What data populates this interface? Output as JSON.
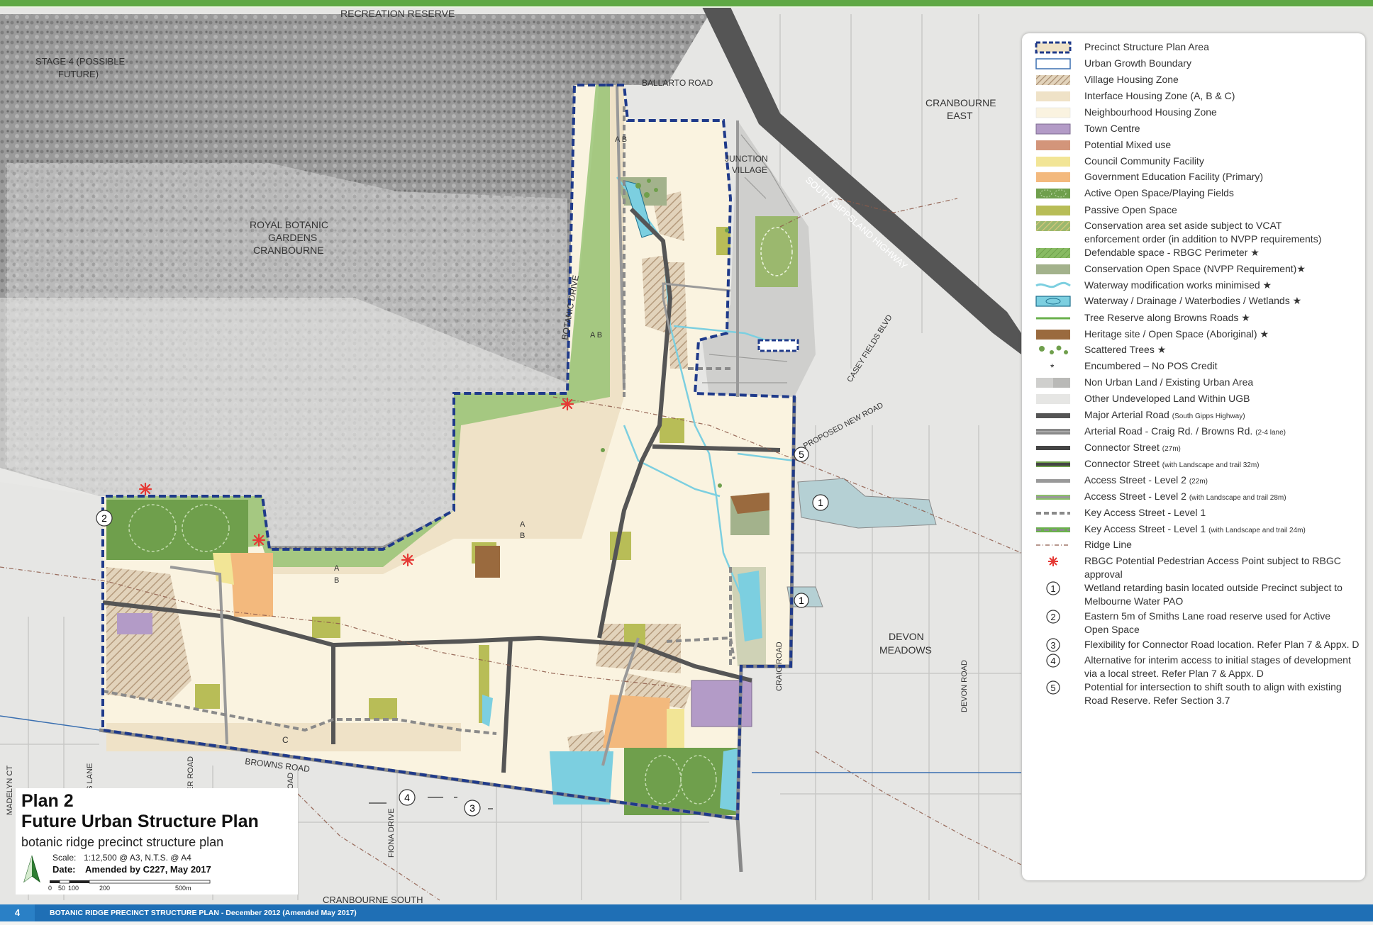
{
  "colors": {
    "boundary": "#1f3a8a",
    "neighbourhood": "#faf3e0",
    "interface": "#efe2c7",
    "village": "#c9b497",
    "town_centre": "#b39bc7",
    "gov_education": "#f3b97d",
    "council": "#f2e596",
    "active_open": "#6f9f4c",
    "passive_open": "#b8bd57",
    "conservation": "#a3b28c",
    "water": "#7ccfe0",
    "heritage": "#9a6a3e",
    "major_road": "#555555",
    "access_point": "#e53935",
    "footer": "#1f6fb5",
    "top_rule": "#5fa844"
  },
  "footer": {
    "page_number": "4",
    "text": "BOTANIC RIDGE PRECINCT STRUCTURE PLAN - December 2012 (Amended May 2017)"
  },
  "title_block": {
    "plan_number": "Plan 2",
    "title": "Future Urban Structure Plan",
    "subtitle": "botanic ridge precinct structure plan",
    "scale_label": "Scale:",
    "scale_value": "1:12,500 @ A3, N.T.S. @ A4",
    "date_label": "Date:",
    "date_value": "Amended by C227, May 2017",
    "scalebar_ticks": [
      "0",
      "50",
      "100",
      "200",
      "500m"
    ]
  },
  "map_labels": {
    "recreation_reserve": "RECREATION RESERVE",
    "stage4_line1": "STAGE 4 (POSSIBLE",
    "stage4_line2": "FUTURE)",
    "ballarto_road": "BALLARTO ROAD",
    "cranbourne_east_1": "CRANBOURNE",
    "cranbourne_east_2": "EAST",
    "junction_1": "JUNCTION",
    "junction_2": "VILLAGE",
    "south_gippsland": "SOUTH GIPPSLAND HIGHWAY",
    "royal_1": "ROYAL BOTANIC",
    "royal_2": "GARDENS",
    "royal_3": "CRANBOURNE",
    "botanic_drive": "BOTANIC DRIVE",
    "casey_fields": "CASEY FIELDS BLVD",
    "proposed_road": "PROPOSED NEW ROAD",
    "devon_1": "DEVON",
    "devon_2": "MEADOWS",
    "devon_road": "DEVON ROAD",
    "craig_road": "CRAIG ROAD",
    "browns_road": "BROWNS ROAD",
    "madelyn_ct": "MADELYN CT",
    "smiths_lane": "SMITHS LANE",
    "pitcher_road": "PITCHER ROAD",
    "kelly_road": "KELLY ROAD",
    "fiona_drive": "FIONA DRIVE",
    "cranbourne_south": "CRANBOURNE SOUTH",
    "ab1": "A B",
    "ab2": "A B",
    "ab3a": "A",
    "ab3b": "B",
    "ab4a": "A",
    "ab4b": "B",
    "c_zone": "C",
    "circle1a": "1",
    "circle1b": "1",
    "circle2": "2",
    "circle3": "3",
    "circle4": "4",
    "circle5": "5"
  },
  "legend": [
    {
      "sym": "psp-area",
      "label": "Precinct Structure Plan Area"
    },
    {
      "sym": "ugb",
      "label": "Urban Growth Boundary"
    },
    {
      "sym": "village",
      "label": "Village Housing Zone"
    },
    {
      "sym": "interface",
      "label": "Interface Housing Zone (A, B & C)"
    },
    {
      "sym": "neighbourhood",
      "label": "Neighbourhood Housing Zone"
    },
    {
      "sym": "town-centre",
      "label": "Town Centre"
    },
    {
      "sym": "mixed-use",
      "label": "Potential Mixed use"
    },
    {
      "sym": "council",
      "label": "Council Community Facility"
    },
    {
      "sym": "gov-edu",
      "label": "Government Education Facility (Primary)"
    },
    {
      "sym": "active-open",
      "label": "Active Open Space/Playing Fields"
    },
    {
      "sym": "passive-open",
      "label": "Passive Open Space"
    },
    {
      "sym": "conservation-vcat",
      "label": "Conservation area set aside subject to VCAT",
      "label2": "enforcement order (in addition to NVPP requirements)"
    },
    {
      "sym": "defendable",
      "label": "Defendable space - RBGC Perimeter ★"
    },
    {
      "sym": "conservation-nvpp",
      "label": "Conservation Open Space (NVPP Requirement)★"
    },
    {
      "sym": "waterway-mod",
      "label": "Waterway modification works minimised ★"
    },
    {
      "sym": "waterway",
      "label": "Waterway / Drainage / Waterbodies / Wetlands ★"
    },
    {
      "sym": "tree-reserve",
      "label": "Tree Reserve along Browns Roads ★"
    },
    {
      "sym": "heritage",
      "label": "Heritage site / Open Space (Aboriginal) ★"
    },
    {
      "sym": "scattered-trees",
      "label": "Scattered Trees ★"
    },
    {
      "sym": "encumbered",
      "label": "Encumbered – No POS Credit"
    },
    {
      "sym": "non-urban",
      "label": "Non Urban Land / Existing Urban Area"
    },
    {
      "sym": "other-undeveloped",
      "label": "Other Undeveloped Land Within UGB"
    },
    {
      "sym": "major-arterial",
      "label": "Major Arterial Road",
      "small": "(South Gipps Highway)"
    },
    {
      "sym": "arterial",
      "label": "Arterial Road - Craig Rd. / Browns Rd.",
      "small": "(2-4 lane)"
    },
    {
      "sym": "connector",
      "label": "Connector Street",
      "small": "(27m)"
    },
    {
      "sym": "connector-ls",
      "label": "Connector Street",
      "small": "(with Landscape and trail 32m)"
    },
    {
      "sym": "access2",
      "label": "Access Street - Level 2",
      "small": "(22m)"
    },
    {
      "sym": "access2-ls",
      "label": "Access Street - Level 2",
      "small": "(with Landscape and trail 28m)"
    },
    {
      "sym": "key-access1",
      "label": "Key Access Street - Level 1"
    },
    {
      "sym": "key-access1-ls",
      "label": "Key Access Street - Level 1",
      "small": "(with Landscape and trail 24m)"
    },
    {
      "sym": "ridge",
      "label": "Ridge Line"
    },
    {
      "sym": "rbgc-access",
      "label": "RBGC Potential Pedestrian Access Point subject to RBGC",
      "label2": "approval"
    },
    {
      "sym": "n1",
      "num": "1",
      "label": "Wetland retarding basin located outside Precinct subject to",
      "label2": "Melbourne Water PAO"
    },
    {
      "sym": "n2",
      "num": "2",
      "label": "Eastern 5m of Smiths Lane road reserve used for Active",
      "label2": "Open Space"
    },
    {
      "sym": "n3",
      "num": "3",
      "label": "Flexibility for Connector Road location. Refer Plan 7 & Appx. D"
    },
    {
      "sym": "n4",
      "num": "4",
      "label": "Alternative for interim access to initial stages of development",
      "label2": "via a local street. Refer Plan 7 & Appx. D"
    },
    {
      "sym": "n5",
      "num": "5",
      "label": "Potential for intersection to shift south to align with existing",
      "label2": "Road Reserve. Refer Section 3.7"
    }
  ]
}
